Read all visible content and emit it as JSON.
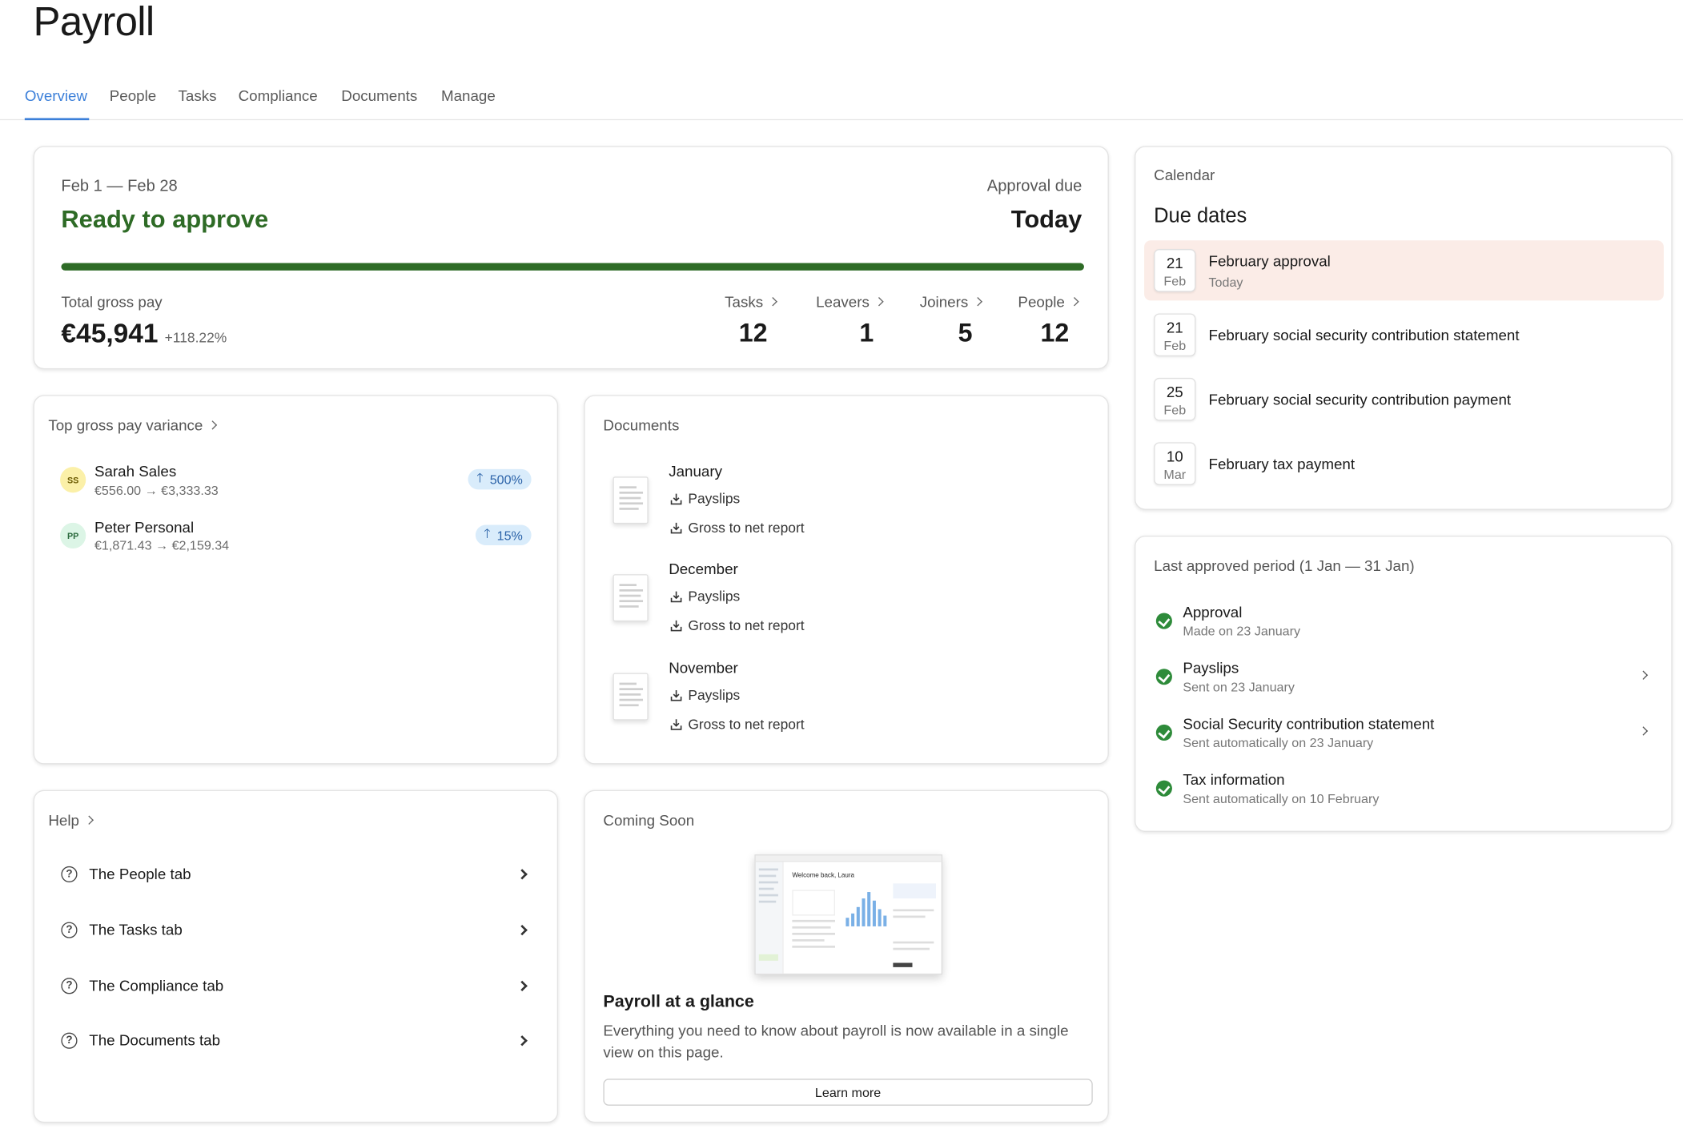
{
  "page": {
    "title": "Payroll"
  },
  "tabs": [
    {
      "label": "Overview",
      "active": true
    },
    {
      "label": "People"
    },
    {
      "label": "Tasks"
    },
    {
      "label": "Compliance"
    },
    {
      "label": "Documents"
    },
    {
      "label": "Manage"
    }
  ],
  "summary": {
    "period": "Feb 1 — Feb 28",
    "status": "Ready to approve",
    "approval_due_label": "Approval due",
    "approval_due_value": "Today",
    "progress_percent": 100,
    "gross_pay_label": "Total gross pay",
    "gross_pay_value": "€45,941",
    "gross_pay_change": "+118.22%",
    "stats": [
      {
        "label": "Tasks",
        "value": "12"
      },
      {
        "label": "Leavers",
        "value": "1"
      },
      {
        "label": "Joiners",
        "value": "5"
      },
      {
        "label": "People",
        "value": "12"
      }
    ]
  },
  "variance": {
    "title": "Top gross pay variance",
    "people": [
      {
        "initials": "SS",
        "name": "Sarah Sales",
        "change": "€556.00 → €3,333.33",
        "badge": "500%",
        "avatar_color": "#fbf0a8",
        "avatar_text_color": "#6b5a00"
      },
      {
        "initials": "PP",
        "name": "Peter Personal",
        "change": "€1,871.43 → €2,159.34",
        "badge": "15%",
        "avatar_color": "#dcf5e6",
        "avatar_text_color": "#2b6a3e"
      }
    ]
  },
  "documents": {
    "title": "Documents",
    "items": [
      {
        "month": "January",
        "payslips": "Payslips",
        "report": "Gross to net report"
      },
      {
        "month": "December",
        "payslips": "Payslips",
        "report": "Gross to net report"
      },
      {
        "month": "November",
        "payslips": "Payslips",
        "report": "Gross to net report"
      }
    ]
  },
  "help": {
    "title": "Help",
    "items": [
      {
        "label": "The People tab"
      },
      {
        "label": "The Tasks tab"
      },
      {
        "label": "The Compliance tab"
      },
      {
        "label": "The Documents tab"
      }
    ]
  },
  "coming_soon": {
    "title": "Coming Soon",
    "preview_heading": "Welcome back, Laura",
    "feature_title": "Payroll at a glance",
    "feature_body": "Everything you need to know about payroll is now available in a single view on this page.",
    "button_label": "Learn more"
  },
  "calendar": {
    "label": "Calendar",
    "title": "Due dates",
    "items": [
      {
        "day": "21",
        "month": "Feb",
        "title": "February approval",
        "sub": "Today",
        "highlight": true
      },
      {
        "day": "21",
        "month": "Feb",
        "title": "February social security contribution statement"
      },
      {
        "day": "25",
        "month": "Feb",
        "title": "February social security contribution payment"
      },
      {
        "day": "10",
        "month": "Mar",
        "title": "February tax payment"
      }
    ]
  },
  "last_approved": {
    "title": "Last approved period (1 Jan — 31 Jan)",
    "items": [
      {
        "title": "Approval",
        "sub": "Made on 23 January",
        "has_chevron": false
      },
      {
        "title": "Payslips",
        "sub": "Sent on 23 January",
        "has_chevron": true
      },
      {
        "title": "Social Security contribution statement",
        "sub": "Sent automatically on 23 January",
        "has_chevron": true
      },
      {
        "title": "Tax information",
        "sub": "Sent automatically on 10 February",
        "has_chevron": false
      }
    ]
  },
  "colors": {
    "accent": "#3b7fd9",
    "success": "#2e6b26",
    "badge_bg": "#d9ecfb",
    "highlight_bg": "#fbece7"
  }
}
